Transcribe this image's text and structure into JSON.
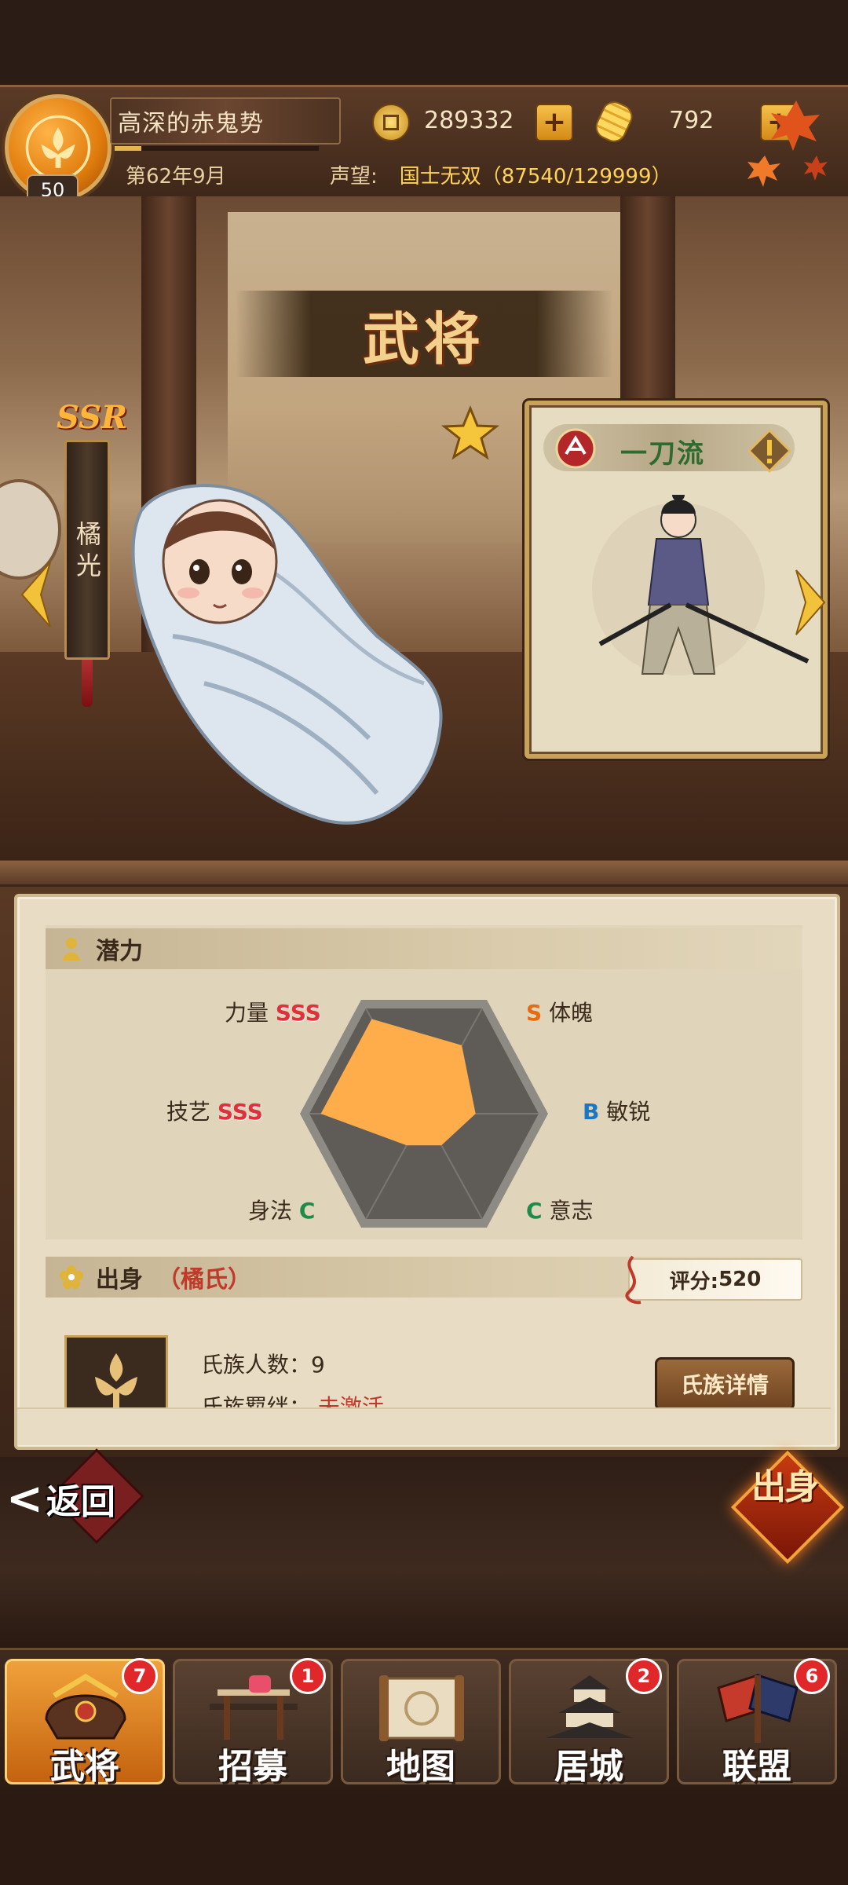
{
  "player": {
    "name": "高深的赤鬼势",
    "level": "50",
    "date": "第62年9月",
    "exp_fraction": 0.13,
    "prestige_label": "声望:",
    "prestige_value": "国士无双（87540/129999）"
  },
  "resources": {
    "coins": "289332",
    "gold": "792",
    "coin_icon": "coin-icon",
    "gold_icon": "gold-bar-icon"
  },
  "scene": {
    "title": "武将"
  },
  "general": {
    "rarity": "SSR",
    "name": "橘光",
    "school": "一刀流"
  },
  "potential": {
    "section_title": "潜力",
    "stats": [
      {
        "name": "力量",
        "grade": "SSS"
      },
      {
        "name": "体魄",
        "grade": "S"
      },
      {
        "name": "敏锐",
        "grade": "B"
      },
      {
        "name": "意志",
        "grade": "C"
      },
      {
        "name": "身法",
        "grade": "C"
      },
      {
        "name": "技艺",
        "grade": "SSS"
      }
    ],
    "radar_levels": {
      "力量": 0.9,
      "体魄": 0.65,
      "敏锐": 0.45,
      "意志": 0.3,
      "身法": 0.3,
      "技艺": 0.9
    }
  },
  "origin": {
    "section_title": "出身",
    "clan": "（橘氏）",
    "score_label": "评分:",
    "score_value": "520",
    "clan_count": "氏族人数：9",
    "clan_bond_label": "氏族羁绊：",
    "clan_bond_value": "未激活",
    "detail_button": "氏族详情"
  },
  "actions": {
    "back_label": "返回",
    "origin_button": "出身"
  },
  "tabs": [
    {
      "label": "武将",
      "badge": "7",
      "active": true
    },
    {
      "label": "招募",
      "badge": "1",
      "active": false
    },
    {
      "label": "地图",
      "badge": "",
      "active": false
    },
    {
      "label": "居城",
      "badge": "2",
      "active": false
    },
    {
      "label": "联盟",
      "badge": "6",
      "active": false
    }
  ],
  "colors": {
    "accent": "#e7b64a",
    "grade_sss": "#e0303a",
    "grade_s": "#e56a10",
    "grade_b": "#1a78c2",
    "grade_c": "#1f8a4a"
  }
}
